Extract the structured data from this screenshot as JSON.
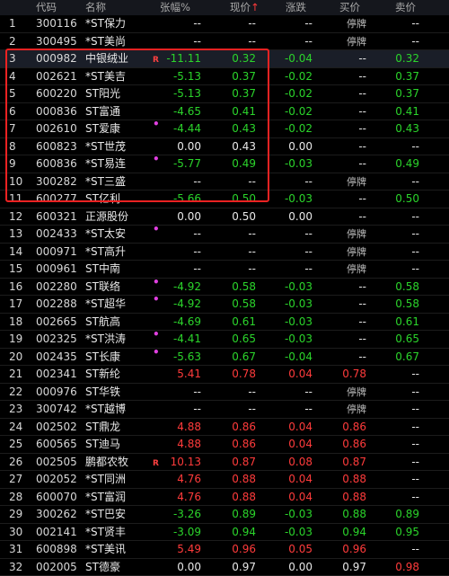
{
  "headers": {
    "code": "代码",
    "name": "名称",
    "chg": "张幅%",
    "price": "现价",
    "price_sort": "↑",
    "diff": "涨跌",
    "bid": "买价",
    "ask": "卖价"
  },
  "colors": {
    "up": "#ff3b3b",
    "down": "#2bd42b",
    "flat": "#e8e8e8",
    "highlight": "#ee2222"
  },
  "rows": [
    {
      "idx": "1",
      "code": "300116",
      "name": "*ST保力",
      "tag": "",
      "chg": "--",
      "price": "--",
      "diff": "--",
      "bid": "停牌",
      "ask": "--",
      "dir": "flat",
      "susp": true
    },
    {
      "idx": "2",
      "code": "300495",
      "name": "*ST美尚",
      "tag": "",
      "chg": "--",
      "price": "--",
      "diff": "--",
      "bid": "停牌",
      "ask": "--",
      "dir": "flat",
      "susp": true
    },
    {
      "idx": "3",
      "code": "000982",
      "name": "中银绒业",
      "tag": "R",
      "chg": "-11.11",
      "price": "0.32",
      "diff": "-0.04",
      "bid": "--",
      "ask": "0.32",
      "dir": "down",
      "sel": true
    },
    {
      "idx": "4",
      "code": "002621",
      "name": "*ST美吉",
      "tag": "",
      "chg": "-5.13",
      "price": "0.37",
      "diff": "-0.02",
      "bid": "--",
      "ask": "0.37",
      "dir": "down"
    },
    {
      "idx": "5",
      "code": "600220",
      "name": "ST阳光",
      "tag": "",
      "chg": "-5.13",
      "price": "0.37",
      "diff": "-0.02",
      "bid": "--",
      "ask": "0.37",
      "dir": "down"
    },
    {
      "idx": "6",
      "code": "000836",
      "name": "ST富通",
      "tag": "",
      "chg": "-4.65",
      "price": "0.41",
      "diff": "-0.02",
      "bid": "--",
      "ask": "0.41",
      "dir": "down"
    },
    {
      "idx": "7",
      "code": "002610",
      "name": "ST爱康",
      "tag": "dot",
      "chg": "-4.44",
      "price": "0.43",
      "diff": "-0.02",
      "bid": "--",
      "ask": "0.43",
      "dir": "down"
    },
    {
      "idx": "8",
      "code": "600823",
      "name": "*ST世茂",
      "tag": "",
      "chg": "0.00",
      "price": "0.43",
      "diff": "0.00",
      "bid": "--",
      "ask": "--",
      "dir": "flat"
    },
    {
      "idx": "9",
      "code": "600836",
      "name": "*ST易连",
      "tag": "dot",
      "chg": "-5.77",
      "price": "0.49",
      "diff": "-0.03",
      "bid": "--",
      "ask": "0.49",
      "dir": "down"
    },
    {
      "idx": "10",
      "code": "300282",
      "name": "*ST三盛",
      "tag": "",
      "chg": "--",
      "price": "--",
      "diff": "--",
      "bid": "停牌",
      "ask": "--",
      "dir": "flat",
      "susp": true
    },
    {
      "idx": "11",
      "code": "600277",
      "name": "ST亿利",
      "tag": "",
      "chg": "-5.66",
      "price": "0.50",
      "diff": "-0.03",
      "bid": "--",
      "ask": "0.50",
      "dir": "down"
    },
    {
      "idx": "12",
      "code": "600321",
      "name": "正源股份",
      "tag": "",
      "chg": "0.00",
      "price": "0.50",
      "diff": "0.00",
      "bid": "--",
      "ask": "--",
      "dir": "flat"
    },
    {
      "idx": "13",
      "code": "002433",
      "name": "*ST太安",
      "tag": "dot",
      "chg": "--",
      "price": "--",
      "diff": "--",
      "bid": "停牌",
      "ask": "--",
      "dir": "flat",
      "susp": true
    },
    {
      "idx": "14",
      "code": "000971",
      "name": "*ST高升",
      "tag": "",
      "chg": "--",
      "price": "--",
      "diff": "--",
      "bid": "停牌",
      "ask": "--",
      "dir": "flat",
      "susp": true
    },
    {
      "idx": "15",
      "code": "000961",
      "name": "ST中南",
      "tag": "",
      "chg": "--",
      "price": "--",
      "diff": "--",
      "bid": "停牌",
      "ask": "--",
      "dir": "flat",
      "susp": true
    },
    {
      "idx": "16",
      "code": "002280",
      "name": "ST联络",
      "tag": "dot",
      "chg": "-4.92",
      "price": "0.58",
      "diff": "-0.03",
      "bid": "--",
      "ask": "0.58",
      "dir": "down"
    },
    {
      "idx": "17",
      "code": "002288",
      "name": "*ST超华",
      "tag": "dot",
      "chg": "-4.92",
      "price": "0.58",
      "diff": "-0.03",
      "bid": "--",
      "ask": "0.58",
      "dir": "down"
    },
    {
      "idx": "18",
      "code": "002665",
      "name": "ST航高",
      "tag": "",
      "chg": "-4.69",
      "price": "0.61",
      "diff": "-0.03",
      "bid": "--",
      "ask": "0.61",
      "dir": "down"
    },
    {
      "idx": "19",
      "code": "002325",
      "name": "*ST洪涛",
      "tag": "dot",
      "chg": "-4.41",
      "price": "0.65",
      "diff": "-0.03",
      "bid": "--",
      "ask": "0.65",
      "dir": "down"
    },
    {
      "idx": "20",
      "code": "002435",
      "name": "ST长康",
      "tag": "dot",
      "chg": "-5.63",
      "price": "0.67",
      "diff": "-0.04",
      "bid": "--",
      "ask": "0.67",
      "dir": "down"
    },
    {
      "idx": "21",
      "code": "002341",
      "name": "ST新纶",
      "tag": "",
      "chg": "5.41",
      "price": "0.78",
      "diff": "0.04",
      "bid": "0.78",
      "ask": "--",
      "dir": "up"
    },
    {
      "idx": "22",
      "code": "000976",
      "name": "ST华铁",
      "tag": "",
      "chg": "--",
      "price": "--",
      "diff": "--",
      "bid": "停牌",
      "ask": "--",
      "dir": "flat",
      "susp": true
    },
    {
      "idx": "23",
      "code": "300742",
      "name": "*ST越博",
      "tag": "",
      "chg": "--",
      "price": "--",
      "diff": "--",
      "bid": "停牌",
      "ask": "--",
      "dir": "flat",
      "susp": true
    },
    {
      "idx": "24",
      "code": "002502",
      "name": "ST鼎龙",
      "tag": "",
      "chg": "4.88",
      "price": "0.86",
      "diff": "0.04",
      "bid": "0.86",
      "ask": "--",
      "dir": "up"
    },
    {
      "idx": "25",
      "code": "600565",
      "name": "ST迪马",
      "tag": "",
      "chg": "4.88",
      "price": "0.86",
      "diff": "0.04",
      "bid": "0.86",
      "ask": "--",
      "dir": "up"
    },
    {
      "idx": "26",
      "code": "002505",
      "name": "鹏都农牧",
      "tag": "R",
      "chg": "10.13",
      "price": "0.87",
      "diff": "0.08",
      "bid": "0.87",
      "ask": "--",
      "dir": "up"
    },
    {
      "idx": "27",
      "code": "002052",
      "name": "*ST同洲",
      "tag": "",
      "chg": "4.76",
      "price": "0.88",
      "diff": "0.04",
      "bid": "0.88",
      "ask": "--",
      "dir": "up"
    },
    {
      "idx": "28",
      "code": "600070",
      "name": "*ST富润",
      "tag": "",
      "chg": "4.76",
      "price": "0.88",
      "diff": "0.04",
      "bid": "0.88",
      "ask": "--",
      "dir": "up"
    },
    {
      "idx": "29",
      "code": "300262",
      "name": "*ST巴安",
      "tag": "",
      "chg": "-3.26",
      "price": "0.89",
      "diff": "-0.03",
      "bid": "0.88",
      "ask": "0.89",
      "dir": "down"
    },
    {
      "idx": "30",
      "code": "002141",
      "name": "*ST贤丰",
      "tag": "",
      "chg": "-3.09",
      "price": "0.94",
      "diff": "-0.03",
      "bid": "0.94",
      "ask": "0.95",
      "dir": "down"
    },
    {
      "idx": "31",
      "code": "600898",
      "name": "*ST美讯",
      "tag": "",
      "chg": "5.49",
      "price": "0.96",
      "diff": "0.05",
      "bid": "0.96",
      "ask": "--",
      "dir": "up"
    },
    {
      "idx": "32",
      "code": "002005",
      "name": "ST德豪",
      "tag": "",
      "chg": "0.00",
      "price": "0.97",
      "diff": "0.00",
      "bid": "0.97",
      "ask": "0.98",
      "dir": "flat",
      "askdir": "up"
    }
  ]
}
